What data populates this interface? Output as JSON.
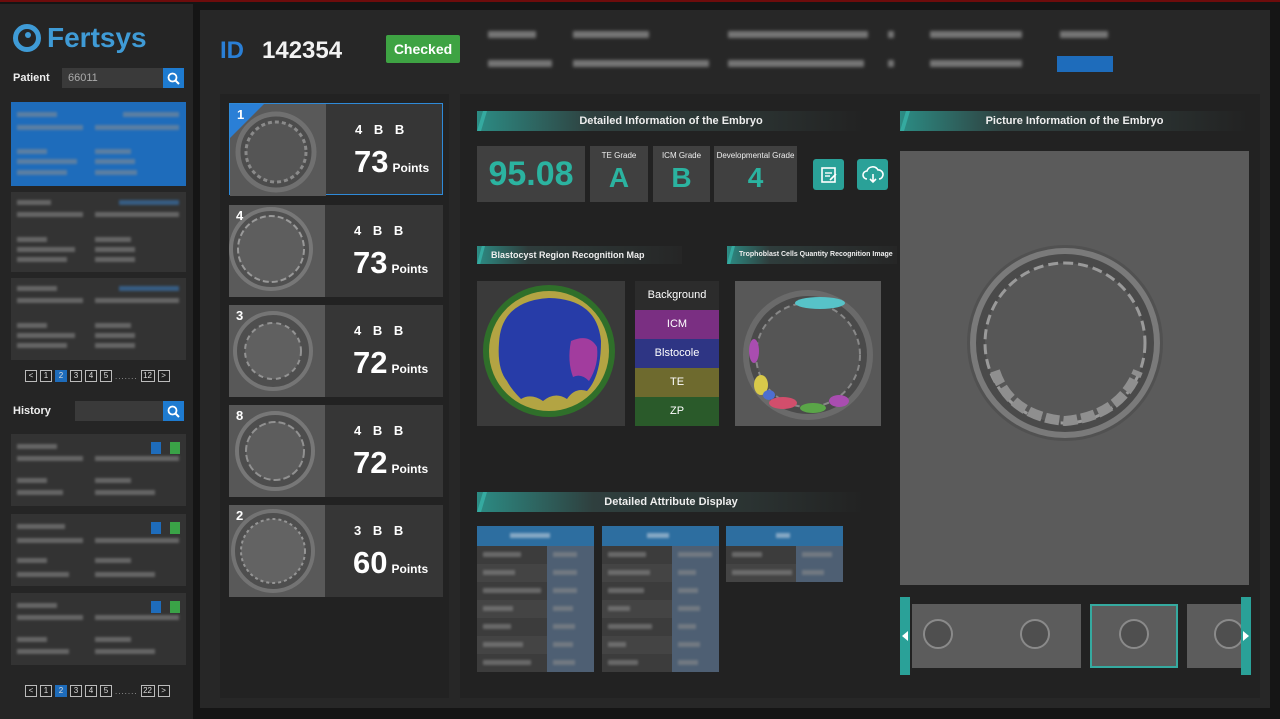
{
  "app": {
    "brand": "Fertsys"
  },
  "sidebar": {
    "patient_label": "Patient",
    "patient_search_value": "66011",
    "history_label": "History",
    "history_search_value": "",
    "patient_pager": {
      "pages": [
        "1",
        "2",
        "3",
        "4",
        "5"
      ],
      "current": "2",
      "ellipsis": ".......",
      "last": "12"
    },
    "history_pager": {
      "pages": [
        "1",
        "2",
        "3",
        "4",
        "5"
      ],
      "current": "2",
      "ellipsis": ".......",
      "last": "22"
    }
  },
  "header": {
    "id_label": "ID",
    "id_value": "142354",
    "status": "Checked"
  },
  "embryos": [
    {
      "num": "1",
      "grades": "4 B B",
      "points": "73",
      "points_unit": "Points"
    },
    {
      "num": "4",
      "grades": "4 B B",
      "points": "73",
      "points_unit": "Points"
    },
    {
      "num": "3",
      "grades": "4 B B",
      "points": "72",
      "points_unit": "Points"
    },
    {
      "num": "8",
      "grades": "4 B B",
      "points": "72",
      "points_unit": "Points"
    },
    {
      "num": "2",
      "grades": "3 B B",
      "points": "60",
      "points_unit": "Points"
    }
  ],
  "detail": {
    "title": "Detailed Information of the Embryo",
    "score": "95.08",
    "te_label": "TE Grade",
    "te_value": "A",
    "icm_label": "ICM Grade",
    "icm_value": "B",
    "dev_label": "Developmental Grade",
    "dev_value": "4"
  },
  "picture_title": "Picture Information of the Embryo",
  "blastocyst_title": "Blastocyst Region Recognition Map",
  "trophoblast_title": "Trophoblast Cells Quantity Recognition Image",
  "legend": [
    {
      "label": "Background",
      "color": "#2c2c2c"
    },
    {
      "label": "ICM",
      "color": "#7a2f82"
    },
    {
      "label": "Blstocole",
      "color": "#2e3584"
    },
    {
      "label": "TE",
      "color": "#6e6a2e"
    },
    {
      "label": "ZP",
      "color": "#2a5a2a"
    }
  ],
  "attribute_title": "Detailed Attribute Display",
  "colors": {
    "accent": "#2aa198",
    "primary": "#1e6cbb",
    "success": "#3ea343"
  }
}
